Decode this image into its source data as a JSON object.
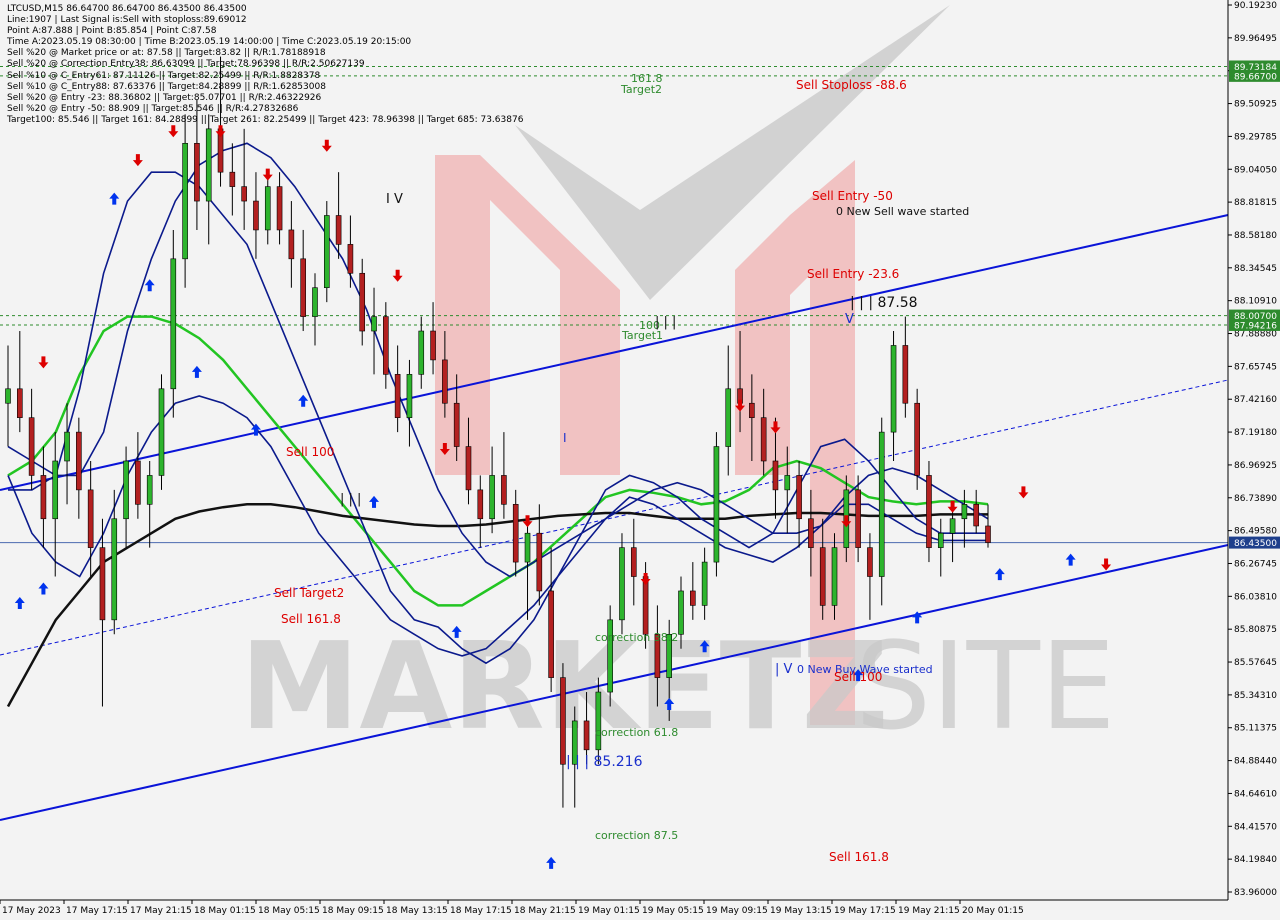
{
  "info": [
    "LTCUSD,M15  86.64700 86.64700 86.43500 86.43500",
    "Line:1907 | Last Signal is:Sell with stoploss:89.69012",
    "Point A:87.888 | Point B:85.854 | Point C:87.58",
    "Time A:2023.05.19 08:30:00 | Time B:2023.05.19 14:00:00 | Time C:2023.05.19 20:15:00",
    "Sell %20 @ Market price or at: 87.58 || Target:83.82 || R/R:1.78188918",
    "Sell %20 @ Correction Entry38: 86.63099 || Target:78.96398 || R/R:2.50627139",
    "Sell %10 @ C_Entry61: 87.11126 || Target:82.25499 || R/R:1.8828378",
    "Sell %10 @ C_Entry88: 87.63376 || Target:84.28899 || R/R:1.62853008",
    "Sell %20 @ Entry -23: 88.36802 || Target:85.07701 || R/R:2.46322926",
    "Sell %20 @ Entry -50: 88.909 || Target:85.546 || R/R:4.27832686",
    "Target100: 85.546 || Target 161: 84.28899 || Target 261: 82.25499 || Target 423: 78.96398 || Target 685: 73.63876"
  ],
  "y_ticks": [
    "90.19230",
    "89.96495",
    "89.74170",
    "89.50925",
    "89.29785",
    "89.04050",
    "88.81815",
    "88.58180",
    "88.34545",
    "88.10910",
    "87.88880",
    "87.65745",
    "87.42160",
    "87.19180",
    "86.96925",
    "86.73890",
    "86.49580",
    "86.26745",
    "86.03810",
    "85.80875",
    "85.57645",
    "85.34310",
    "85.11375",
    "84.88440",
    "84.64610",
    "84.41570",
    "84.19840",
    "83.96000"
  ],
  "x_ticks": [
    "17 May 2023",
    "17 May 17:15",
    "17 May 21:15",
    "18 May 01:15",
    "18 May 05:15",
    "18 May 09:15",
    "18 May 13:15",
    "18 May 17:15",
    "18 May 21:15",
    "19 May 01:15",
    "19 May 05:15",
    "19 May 09:15",
    "19 May 13:15",
    "19 May 17:15",
    "19 May 21:15",
    "20 May 01:15"
  ],
  "price_labels": {
    "stoploss_hi": "89.73184",
    "stoploss_lo": "89.66700",
    "entry_hi": "88.00700",
    "entry_lo": "87.94216",
    "current": "86.43500"
  },
  "annotations": {
    "sell_stoploss": "Sell Stoploss -88.6",
    "target2_top_num": "161.8",
    "target2_top": "Target2",
    "sell_entry_50": "Sell Entry -50",
    "new_sell_wave": "0 New Sell wave started",
    "sell_entry_236": "Sell Entry -23.6",
    "wave_iii_top": "| | | 87.58",
    "wave_v_top": "V",
    "target1_num": "100",
    "target1_iii": "| | |",
    "target1": "Target1",
    "wave_iv": "I V",
    "sell_100_left": "Sell 100",
    "wave_iii_left": "| | |",
    "sell_target2": "Sell Target2",
    "sell_1618_left": "Sell 161.8",
    "correction_382": "correction 38.2",
    "wave_iv_bottom": "| V",
    "new_buy_wave": "0 New Buy Wave started",
    "sell_100_right": "Sell 100",
    "correction_618": "correction 61.8",
    "wave_iii_bottom": "| | | 85.216",
    "correction_875": "correction 87.5",
    "sell_1618_right": "Sell 161.8",
    "wave_i": "I"
  },
  "watermark": {
    "text_left": "MARKETZ",
    "text_right": "SITE"
  },
  "colors": {
    "background": "#f3f3f3",
    "channel": "#0a14d8",
    "ma_green": "#22c522",
    "ma_black": "#111111",
    "ma_navy": "#0b1a8c",
    "sell_red": "#dd0000",
    "buy_blue": "#0033ee",
    "target_green": "#2e8b2e",
    "current_price_box": "#1e3f8c",
    "stoploss_box": "#2e8b2e"
  },
  "chart_data": {
    "type": "candlestick",
    "symbol": "LTCUSD",
    "timeframe": "M15",
    "ylim": [
      83.96,
      90.1923
    ],
    "last_price": 86.435,
    "levels": {
      "stoploss_hi": 89.73184,
      "stoploss_lo": 89.667,
      "entry_hi": 88.007,
      "entry_lo": 87.94216
    },
    "candles": [
      [
        87.4,
        87.8,
        87.1,
        87.5
      ],
      [
        87.5,
        87.9,
        87.2,
        87.3
      ],
      [
        87.3,
        87.5,
        86.8,
        86.9
      ],
      [
        86.9,
        87.1,
        86.4,
        86.6
      ],
      [
        86.6,
        87.2,
        86.2,
        87.0
      ],
      [
        87.0,
        87.4,
        86.7,
        87.2
      ],
      [
        87.2,
        87.3,
        86.6,
        86.8
      ],
      [
        86.8,
        87.0,
        86.2,
        86.4
      ],
      [
        86.4,
        86.6,
        85.3,
        85.9
      ],
      [
        85.9,
        86.8,
        85.8,
        86.6
      ],
      [
        86.6,
        87.1,
        86.4,
        87.0
      ],
      [
        87.0,
        87.2,
        86.6,
        86.7
      ],
      [
        86.7,
        87.0,
        86.4,
        86.9
      ],
      [
        86.9,
        87.6,
        86.8,
        87.5
      ],
      [
        87.5,
        88.6,
        87.3,
        88.4
      ],
      [
        88.4,
        89.4,
        88.2,
        89.2
      ],
      [
        89.2,
        89.5,
        88.6,
        88.8
      ],
      [
        88.8,
        89.4,
        88.5,
        89.3
      ],
      [
        89.3,
        89.8,
        88.9,
        89.0
      ],
      [
        89.0,
        89.2,
        88.7,
        88.9
      ],
      [
        88.9,
        89.3,
        88.6,
        88.8
      ],
      [
        88.8,
        89.0,
        88.4,
        88.6
      ],
      [
        88.6,
        89.0,
        88.5,
        88.9
      ],
      [
        88.9,
        89.0,
        88.5,
        88.6
      ],
      [
        88.6,
        88.8,
        88.2,
        88.4
      ],
      [
        88.4,
        88.6,
        87.9,
        88.0
      ],
      [
        88.0,
        88.3,
        87.8,
        88.2
      ],
      [
        88.2,
        88.8,
        88.1,
        88.7
      ],
      [
        88.7,
        89.0,
        88.4,
        88.5
      ],
      [
        88.5,
        88.7,
        88.2,
        88.3
      ],
      [
        88.3,
        88.4,
        87.8,
        87.9
      ],
      [
        87.9,
        88.2,
        87.6,
        88.0
      ],
      [
        88.0,
        88.1,
        87.5,
        87.6
      ],
      [
        87.6,
        87.8,
        87.2,
        87.3
      ],
      [
        87.3,
        87.7,
        87.1,
        87.6
      ],
      [
        87.6,
        88.0,
        87.5,
        87.9
      ],
      [
        87.9,
        88.1,
        87.6,
        87.7
      ],
      [
        87.7,
        87.9,
        87.3,
        87.4
      ],
      [
        87.4,
        87.6,
        87.0,
        87.1
      ],
      [
        87.1,
        87.3,
        86.7,
        86.8
      ],
      [
        86.8,
        86.9,
        86.4,
        86.6
      ],
      [
        86.6,
        87.1,
        86.5,
        86.9
      ],
      [
        86.9,
        87.2,
        86.6,
        86.7
      ],
      [
        86.7,
        86.8,
        86.2,
        86.3
      ],
      [
        86.3,
        86.6,
        85.9,
        86.5
      ],
      [
        86.5,
        86.7,
        86.0,
        86.1
      ],
      [
        86.1,
        86.4,
        85.4,
        85.5
      ],
      [
        85.5,
        85.6,
        84.6,
        84.9
      ],
      [
        84.9,
        85.3,
        84.6,
        85.2
      ],
      [
        85.2,
        85.4,
        84.9,
        85.0
      ],
      [
        85.0,
        85.5,
        84.9,
        85.4
      ],
      [
        85.4,
        86.0,
        85.3,
        85.9
      ],
      [
        85.9,
        86.5,
        85.8,
        86.4
      ],
      [
        86.4,
        86.6,
        86.0,
        86.2
      ],
      [
        86.2,
        86.3,
        85.7,
        85.8
      ],
      [
        85.8,
        86.0,
        85.3,
        85.5
      ],
      [
        85.5,
        85.9,
        85.2,
        85.8
      ],
      [
        85.8,
        86.2,
        85.7,
        86.1
      ],
      [
        86.1,
        86.3,
        85.9,
        86.0
      ],
      [
        86.0,
        86.4,
        85.9,
        86.3
      ],
      [
        86.3,
        87.2,
        86.2,
        87.1
      ],
      [
        87.1,
        87.8,
        86.9,
        87.5
      ],
      [
        87.5,
        87.9,
        87.2,
        87.4
      ],
      [
        87.4,
        87.6,
        87.0,
        87.3
      ],
      [
        87.3,
        87.5,
        86.9,
        87.0
      ],
      [
        87.0,
        87.3,
        86.6,
        86.8
      ],
      [
        86.8,
        87.1,
        86.5,
        86.9
      ],
      [
        86.9,
        87.0,
        86.4,
        86.6
      ],
      [
        86.6,
        86.8,
        86.2,
        86.4
      ],
      [
        86.4,
        86.6,
        85.9,
        86.0
      ],
      [
        86.0,
        86.5,
        85.9,
        86.4
      ],
      [
        86.4,
        86.9,
        86.3,
        86.8
      ],
      [
        86.8,
        86.9,
        86.3,
        86.4
      ],
      [
        86.4,
        86.5,
        85.9,
        86.2
      ],
      [
        86.2,
        87.3,
        86.0,
        87.2
      ],
      [
        87.2,
        87.9,
        87.0,
        87.8
      ],
      [
        87.8,
        88.0,
        87.3,
        87.4
      ],
      [
        87.4,
        87.5,
        86.8,
        86.9
      ],
      [
        86.9,
        87.0,
        86.3,
        86.4
      ],
      [
        86.4,
        86.6,
        86.2,
        86.5
      ],
      [
        86.5,
        86.7,
        86.3,
        86.6
      ],
      [
        86.6,
        86.8,
        86.4,
        86.7
      ],
      [
        86.7,
        86.8,
        86.5,
        86.55
      ],
      [
        86.55,
        86.7,
        86.4,
        86.435
      ]
    ],
    "series": [
      {
        "values": [
          86.9,
          87.0,
          87.2,
          87.6,
          87.9,
          88.0,
          88.0,
          87.95,
          87.85,
          87.7,
          87.5,
          87.3,
          87.1,
          86.9,
          86.7,
          86.5,
          86.3,
          86.1,
          86.0,
          86.0,
          86.1,
          86.2,
          86.3,
          86.45,
          86.6,
          86.75,
          86.8,
          86.78,
          86.75,
          86.7,
          86.72,
          86.8,
          86.95,
          87.0,
          86.95,
          86.85,
          86.75,
          86.72,
          86.7,
          86.72,
          86.72,
          86.7
        ]
      },
      {
        "values": [
          85.3,
          85.6,
          85.9,
          86.1,
          86.3,
          86.4,
          86.5,
          86.6,
          86.65,
          86.68,
          86.7,
          86.7,
          86.68,
          86.65,
          86.62,
          86.6,
          86.58,
          86.56,
          86.55,
          86.55,
          86.56,
          86.58,
          86.6,
          86.62,
          86.63,
          86.64,
          86.64,
          86.62,
          86.6,
          86.6,
          86.6,
          86.62,
          86.63,
          86.64,
          86.64,
          86.63,
          86.62,
          86.62,
          86.62,
          86.63,
          86.63,
          86.63
        ]
      },
      {
        "values": [
          87.1,
          87.0,
          86.9,
          86.9,
          87.2,
          87.9,
          88.4,
          88.8,
          89.05,
          89.15,
          89.2,
          89.1,
          88.9,
          88.65,
          88.4,
          88.05,
          87.6,
          87.2,
          86.8,
          86.5,
          86.3,
          86.2,
          86.3,
          86.4,
          86.5,
          86.6,
          86.7,
          86.8,
          86.85,
          86.8,
          86.7,
          86.6,
          86.5,
          86.5,
          86.55,
          86.75,
          86.9,
          86.95,
          86.9,
          86.8,
          86.7,
          86.6
        ]
      },
      {
        "values": [
          86.8,
          86.8,
          86.9,
          87.5,
          88.3,
          88.8,
          89.0,
          89.0,
          88.9,
          88.7,
          88.5,
          88.1,
          87.7,
          87.3,
          86.9,
          86.5,
          86.1,
          85.9,
          85.85,
          85.7,
          85.6,
          85.7,
          85.9,
          86.2,
          86.5,
          86.8,
          86.9,
          86.85,
          86.75,
          86.6,
          86.5,
          86.4,
          86.5,
          86.8,
          87.1,
          87.15,
          87.0,
          86.8,
          86.6,
          86.5,
          86.5,
          86.5
        ]
      },
      {
        "values": [
          86.9,
          86.5,
          86.3,
          86.2,
          86.5,
          86.9,
          87.2,
          87.4,
          87.45,
          87.4,
          87.3,
          87.1,
          86.8,
          86.5,
          86.3,
          86.1,
          85.9,
          85.8,
          85.7,
          85.65,
          85.7,
          85.85,
          86.0,
          86.2,
          86.4,
          86.6,
          86.75,
          86.7,
          86.6,
          86.5,
          86.4,
          86.35,
          86.3,
          86.4,
          86.55,
          86.7,
          86.7,
          86.6,
          86.5,
          86.45,
          86.45,
          86.45
        ]
      }
    ],
    "sell_signals": [
      [
        3,
        87.6
      ],
      [
        11,
        89.0
      ],
      [
        14,
        89.2
      ],
      [
        18,
        89.2
      ],
      [
        22,
        88.9
      ],
      [
        27,
        89.1
      ],
      [
        33,
        88.2
      ],
      [
        37,
        87.0
      ],
      [
        44,
        86.5
      ],
      [
        54,
        86.1
      ],
      [
        62,
        87.3
      ],
      [
        65,
        87.15
      ],
      [
        71,
        86.5
      ],
      [
        80,
        86.6
      ],
      [
        86,
        86.7
      ],
      [
        93,
        86.2
      ]
    ],
    "buy_signals": [
      [
        1,
        86.1
      ],
      [
        3,
        86.2
      ],
      [
        9,
        88.9
      ],
      [
        12,
        88.3
      ],
      [
        16,
        87.7
      ],
      [
        21,
        87.3
      ],
      [
        25,
        87.5
      ],
      [
        31,
        86.8
      ],
      [
        38,
        85.9
      ],
      [
        46,
        84.3
      ],
      [
        56,
        85.4
      ],
      [
        59,
        85.8
      ],
      [
        72,
        85.6
      ],
      [
        77,
        86.0
      ],
      [
        84,
        86.3
      ],
      [
        90,
        86.4
      ]
    ]
  }
}
